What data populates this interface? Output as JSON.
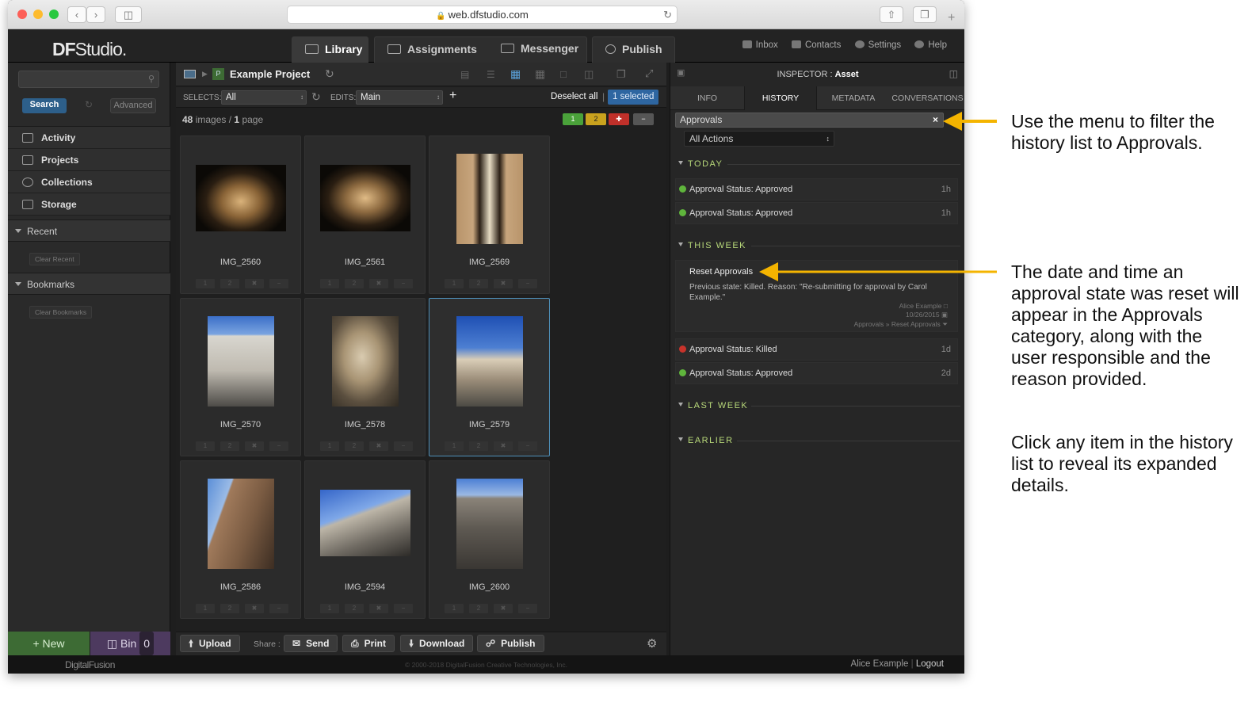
{
  "browser": {
    "url": "web.dfstudio.com"
  },
  "app": {
    "logo_df": "DF",
    "logo_studio": "Studio.",
    "tabs": [
      {
        "label": "Library",
        "active": true
      },
      {
        "label": "Assignments",
        "active": false
      },
      {
        "label": "Messenger",
        "active": false
      },
      {
        "label": "Publish",
        "active": false
      }
    ],
    "top_links": [
      "Inbox",
      "Contacts",
      "Settings",
      "Help"
    ]
  },
  "sidebar": {
    "search_button": "Search",
    "advanced_button": "Advanced",
    "nav_items": [
      "Activity",
      "Projects",
      "Collections",
      "Storage"
    ],
    "recent_label": "Recent",
    "clear_recent": "Clear Recent",
    "bookmarks_label": "Bookmarks",
    "clear_bookmarks": "Clear Bookmarks",
    "new_button": "+ New",
    "bin_button": "Bin",
    "bin_count": "0"
  },
  "library": {
    "project_badge": "P",
    "project_title": "Example Project",
    "selects_label": "SELECTS:",
    "selects_value": "All",
    "edits_label": "EDITS:",
    "edits_value": "Main",
    "deselect_all": "Deselect all",
    "selected_count": "1 selected",
    "image_count": "48",
    "images_label": "images",
    "page_count": "1",
    "page_label": "page",
    "flags": {
      "green": "1",
      "yellow": "2",
      "red": "✚",
      "minus": "−",
      "colors": {
        "green": "#4aa23a",
        "yellow": "#c9a21e",
        "red": "#c0302a"
      }
    },
    "images": [
      {
        "name": "IMG_2560",
        "selected": false
      },
      {
        "name": "IMG_2561",
        "selected": false
      },
      {
        "name": "IMG_2569",
        "selected": false
      },
      {
        "name": "IMG_2570",
        "selected": false
      },
      {
        "name": "IMG_2578",
        "selected": false
      },
      {
        "name": "IMG_2579",
        "selected": true
      },
      {
        "name": "IMG_2586",
        "selected": false
      },
      {
        "name": "IMG_2594",
        "selected": false
      },
      {
        "name": "IMG_2600",
        "selected": false
      }
    ],
    "rating_buttons": [
      "1",
      "2",
      "✖",
      "−"
    ],
    "footer": {
      "upload": "Upload",
      "share_label": "Share :",
      "send": "Send",
      "print": "Print",
      "download": "Download",
      "publish": "Publish"
    }
  },
  "inspector": {
    "title_prefix": "INSPECTOR :",
    "title_value": "Asset",
    "tabs": [
      {
        "label": "INFO",
        "active": false
      },
      {
        "label": "HISTORY",
        "active": true
      },
      {
        "label": "METADATA",
        "active": false
      },
      {
        "label": "CONVERSATIONS",
        "active": false
      }
    ],
    "filter_value": "Approvals",
    "filter_clear": "×",
    "actions_select": "All Actions",
    "sections": {
      "today": "TODAY",
      "this_week": "THIS WEEK",
      "last_week": "LAST WEEK",
      "earlier": "EARLIER"
    },
    "today_items": [
      {
        "text": "Approval Status: Approved",
        "time": "1h",
        "status": "approved"
      },
      {
        "text": "Approval Status: Approved",
        "time": "1h",
        "status": "approved"
      }
    ],
    "expanded": {
      "title": "Reset Approvals",
      "detail": "Previous state: Killed. Reason: \"Re-submitting for approval by Carol Example.\"",
      "user": "Alice Example",
      "date": "10/26/2015",
      "category": "Approvals",
      "sep": "»",
      "action": "Reset Approvals"
    },
    "week_items": [
      {
        "text": "Approval Status: Killed",
        "time": "1d",
        "status": "killed"
      },
      {
        "text": "Approval Status: Approved",
        "time": "2d",
        "status": "approved"
      }
    ],
    "status_colors": {
      "approved": "#5fb53c",
      "killed": "#c8332b"
    }
  },
  "footer": {
    "brand": "DigitalFusion",
    "copyright": "© 2000-2018 DigitalFusion Creative Technologies, Inc.",
    "user": "Alice Example",
    "logout": "Logout"
  },
  "annotations": {
    "note1": "Use the menu to filter the history list to Approvals.",
    "note2": "The date and time an approval state was reset will appear in the Approvals category, along with the user responsible and the reason provided.",
    "note3": "Click any item in the history list to reveal its expanded details.",
    "arrow_color": "#f4b400"
  }
}
